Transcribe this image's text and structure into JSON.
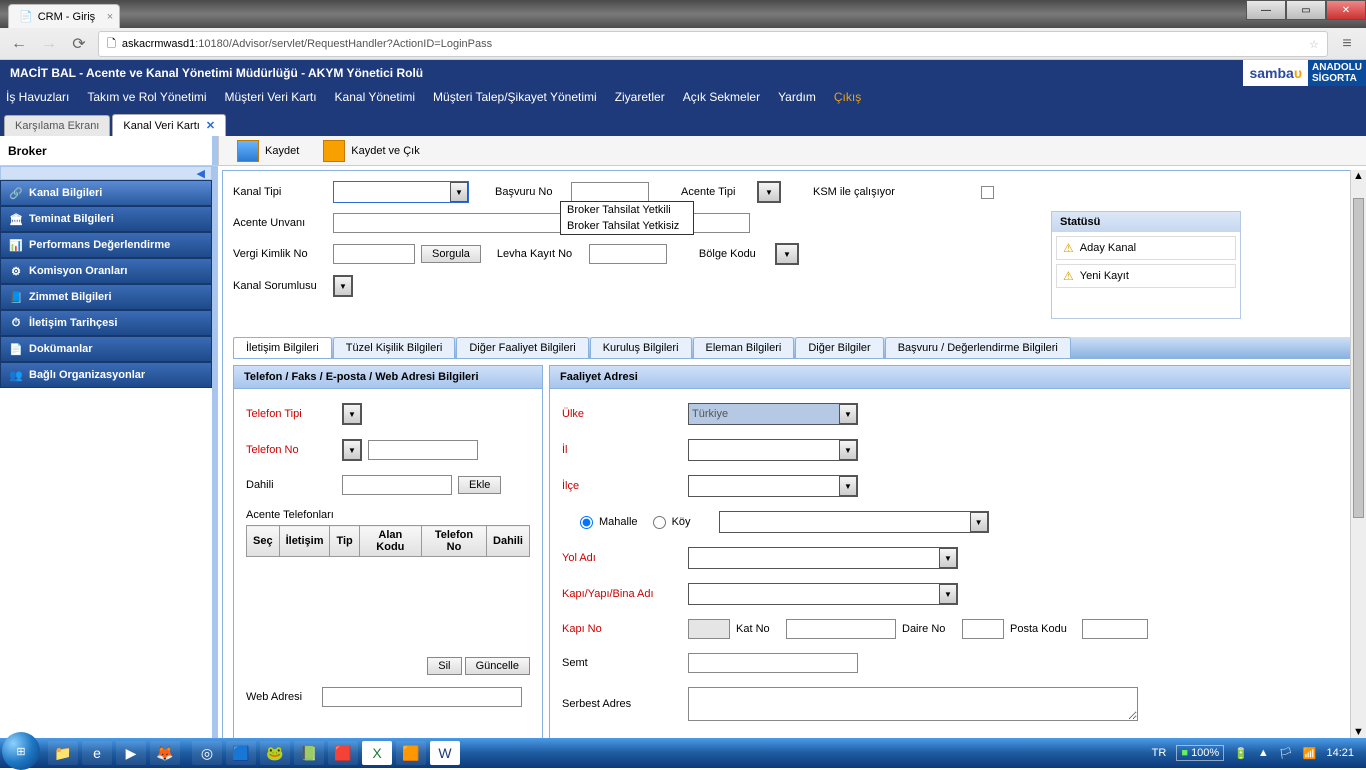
{
  "browser": {
    "tab_title": "CRM - Giriş",
    "url_host": "askacrmwasd1",
    "url_path": ":10180/Advisor/servlet/RequestHandler?ActionID=LoginPass"
  },
  "header": {
    "title": "MACİT BAL - Acente ve Kanal Yönetimi Müdürlüğü - AKYM Yönetici Rolü",
    "logo1": "samba",
    "logo2_line1": "ANADOLU",
    "logo2_line2": "SİGORTA"
  },
  "menu": [
    "İş Havuzları",
    "Takım ve Rol Yönetimi",
    "Müşteri Veri Kartı",
    "Kanal Yönetimi",
    "Müşteri Talep/Şikayet Yönetimi",
    "Ziyaretler",
    "Açık Sekmeler",
    "Yardım",
    "Çıkış"
  ],
  "doc_tabs": [
    {
      "label": "Karşılama Ekranı",
      "active": false
    },
    {
      "label": "Kanal Veri Kartı",
      "active": true
    }
  ],
  "toolbar": {
    "context": "Broker",
    "save": "Kaydet",
    "save_exit": "Kaydet ve Çık"
  },
  "sidenav": [
    {
      "label": "Kanal Bilgileri",
      "icon": "🔗",
      "active": true
    },
    {
      "label": "Teminat Bilgileri",
      "icon": "🏛",
      "active": false
    },
    {
      "label": "Performans Değerlendirme",
      "icon": "📊",
      "active": false
    },
    {
      "label": "Komisyon Oranları",
      "icon": "⚙",
      "active": false
    },
    {
      "label": "Zimmet Bilgileri",
      "icon": "📘",
      "active": false
    },
    {
      "label": "İletişim Tarihçesi",
      "icon": "⏱",
      "active": false
    },
    {
      "label": "Dokümanlar",
      "icon": "📄",
      "active": false
    },
    {
      "label": "Bağlı Organizasyonlar",
      "icon": "👥",
      "active": false
    }
  ],
  "form": {
    "kanal_tipi": "Kanal Tipi",
    "basvuru_no": "Başvuru No",
    "acente_tipi": "Acente Tipi",
    "ksm": "KSM ile çalışıyor",
    "acente_unvani": "Acente Unvanı",
    "vergi_kimlik": "Vergi Kimlik No",
    "sorgula": "Sorgula",
    "levha_kayit": "Levha Kayıt No",
    "bolge_kodu": "Bölge Kodu",
    "kanal_sorumlusu": "Kanal Sorumlusu"
  },
  "dropdown": {
    "opt1": "Broker Tahsilat Yetkili",
    "opt2": "Broker Tahsilat Yetkisiz"
  },
  "status": {
    "title": "Statüsü",
    "item1": "Aday Kanal",
    "item2": "Yeni Kayıt"
  },
  "btabs": [
    "İletişim Bilgileri",
    "Tüzel Kişilik Bilgileri",
    "Diğer Faaliyet Bilgileri",
    "Kuruluş Bilgileri",
    "Eleman Bilgileri",
    "Diğer Bilgiler",
    "Başvuru / Değerlendirme Bilgileri"
  ],
  "panel_left": {
    "title": "Telefon / Faks / E-posta / Web Adresi Bilgileri",
    "telefon_tipi": "Telefon Tipi",
    "telefon_no": "Telefon No",
    "dahili": "Dahili",
    "ekle": "Ekle",
    "acente_tel": "Acente Telefonları",
    "cols": [
      "Seç",
      "İletişim",
      "Tip",
      "Alan Kodu",
      "Telefon No",
      "Dahili"
    ],
    "sil": "Sil",
    "guncelle": "Güncelle",
    "web": "Web Adresi"
  },
  "panel_right": {
    "title": "Faaliyet Adresi",
    "ulke": "Ülke",
    "ulke_val": "Türkiye",
    "il": "İl",
    "ilce": "İlçe",
    "mahalle": "Mahalle",
    "koy": "Köy",
    "yol": "Yol Adı",
    "kapi_yapi": "Kapı/Yapı/Bina Adı",
    "kapi_no": "Kapı No",
    "kat_no": "Kat No",
    "daire_no": "Daire No",
    "posta": "Posta Kodu",
    "semt": "Semt",
    "serbest": "Serbest Adres"
  },
  "tray": {
    "lang": "TR",
    "zoom": "100%",
    "time": "14:21"
  }
}
